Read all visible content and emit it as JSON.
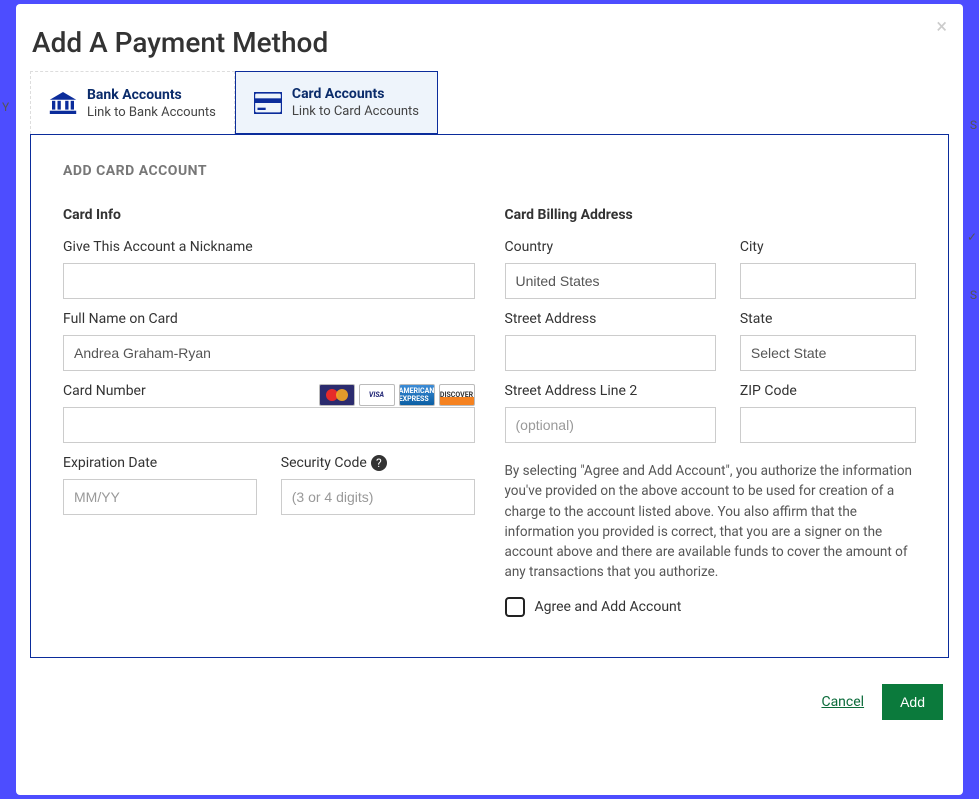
{
  "modal": {
    "title": "Add A Payment Method"
  },
  "tabs": {
    "bank": {
      "title": "Bank Accounts",
      "subtitle": "Link to Bank Accounts"
    },
    "card": {
      "title": "Card Accounts",
      "subtitle": "Link to Card Accounts"
    }
  },
  "section": {
    "title": "ADD CARD ACCOUNT"
  },
  "cardInfo": {
    "header": "Card Info",
    "nickname": {
      "label": "Give This Account a Nickname",
      "value": ""
    },
    "fullName": {
      "label": "Full Name on Card",
      "value": "Andrea Graham-Ryan"
    },
    "cardNumber": {
      "label": "Card Number",
      "value": ""
    },
    "brands": {
      "mc": "MasterCard",
      "visa": "VISA",
      "amex": "AMERICAN EXPRESS",
      "disc": "DISCOVER"
    },
    "expiration": {
      "label": "Expiration Date",
      "placeholder": "MM/YY",
      "value": ""
    },
    "security": {
      "label": "Security Code",
      "placeholder": "(3 or 4 digits)",
      "value": ""
    }
  },
  "billing": {
    "header": "Card Billing Address",
    "country": {
      "label": "Country",
      "selected": "United States"
    },
    "city": {
      "label": "City",
      "value": ""
    },
    "street1": {
      "label": "Street Address",
      "value": ""
    },
    "state": {
      "label": "State",
      "selected": "Select State"
    },
    "street2": {
      "label": "Street Address Line 2",
      "placeholder": "(optional)",
      "value": ""
    },
    "zip": {
      "label": "ZIP Code",
      "value": ""
    }
  },
  "legal": {
    "text": "By selecting \"Agree and Add Account\", you authorize the information you've provided on the above account to be used for creation of a charge to the account listed above. You also affirm that the information you provided is correct, that you are a signer on the account above and there are available funds to cover the amount of any transactions that you authorize.",
    "checkboxLabel": "Agree and Add Account"
  },
  "footer": {
    "cancel": "Cancel",
    "add": "Add"
  }
}
